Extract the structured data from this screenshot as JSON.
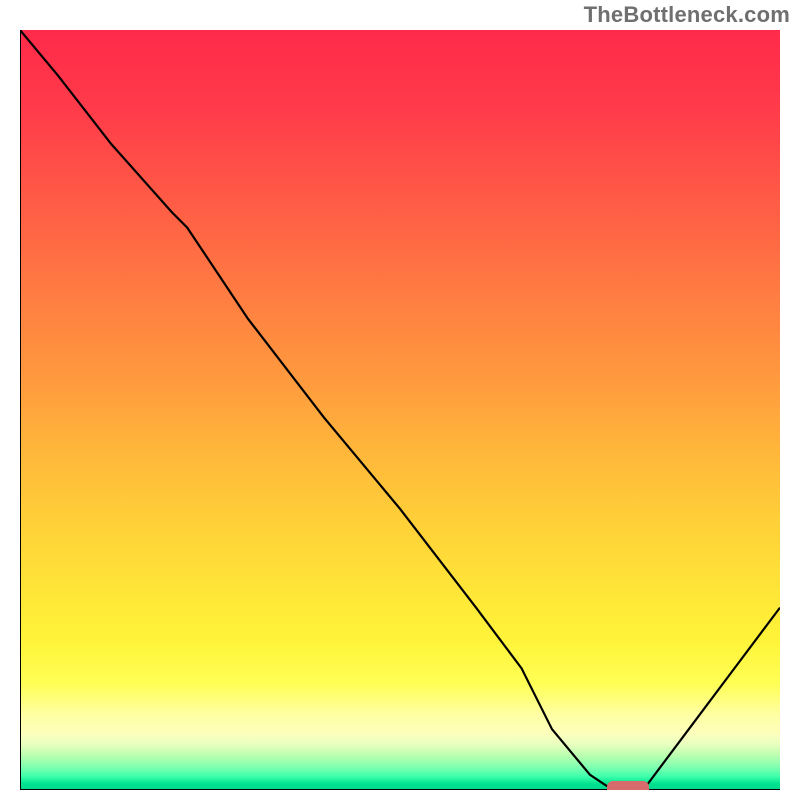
{
  "watermark": "TheBottleneck.com",
  "chart_data": {
    "type": "line",
    "title": "",
    "xlabel": "",
    "ylabel": "",
    "xlim": [
      0,
      100
    ],
    "ylim": [
      0,
      100
    ],
    "grid": false,
    "legend": false,
    "annotations": [],
    "gradient_zones": [
      {
        "label": "high-bottleneck",
        "color": "#ff2a4a",
        "y_pct": 0
      },
      {
        "label": "mid-bottleneck",
        "color": "#ffb83a",
        "y_pct": 55
      },
      {
        "label": "low-bottleneck",
        "color": "#ffff55",
        "y_pct": 86
      },
      {
        "label": "optimal",
        "color": "#00e28e",
        "y_pct": 100
      }
    ],
    "series": [
      {
        "name": "bottleneck-curve",
        "x": [
          0,
          5,
          12,
          20,
          22,
          30,
          40,
          50,
          60,
          66,
          70,
          75,
          78,
          82,
          88,
          94,
          100
        ],
        "values": [
          100,
          94,
          85,
          76,
          74,
          62,
          49,
          37,
          24,
          16,
          8,
          2,
          0,
          0,
          8,
          16,
          24
        ]
      }
    ],
    "marker": {
      "x": 80,
      "y": 0,
      "color": "#d66a6c",
      "shape": "pill"
    }
  }
}
